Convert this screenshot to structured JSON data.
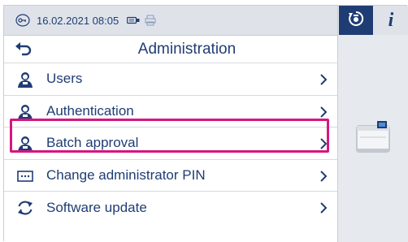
{
  "status_bar": {
    "datetime": "16.02.2021 08:05",
    "icons": [
      "key-circle-icon",
      "usb-stick-icon",
      "printer-icon"
    ]
  },
  "right_panel": {
    "active_tab_icon": "sterilizer-cycle-icon",
    "info_tab_label": "i",
    "device_image": "autoclave-device-icon"
  },
  "header": {
    "title": "Administration",
    "back_icon": "back-arrow-icon"
  },
  "menu": {
    "items": [
      {
        "label": "Users",
        "icon": "user-icon"
      },
      {
        "label": "Authentication",
        "icon": "user-icon"
      },
      {
        "label": "Batch approval",
        "icon": "user-icon",
        "highlighted": true
      },
      {
        "label": "Change administrator PIN",
        "icon": "pin-field-icon"
      },
      {
        "label": "Software update",
        "icon": "refresh-icon"
      }
    ]
  },
  "colors": {
    "brand": "#1f3d74",
    "highlight": "#d6167e",
    "background": "#e6e9ee"
  }
}
